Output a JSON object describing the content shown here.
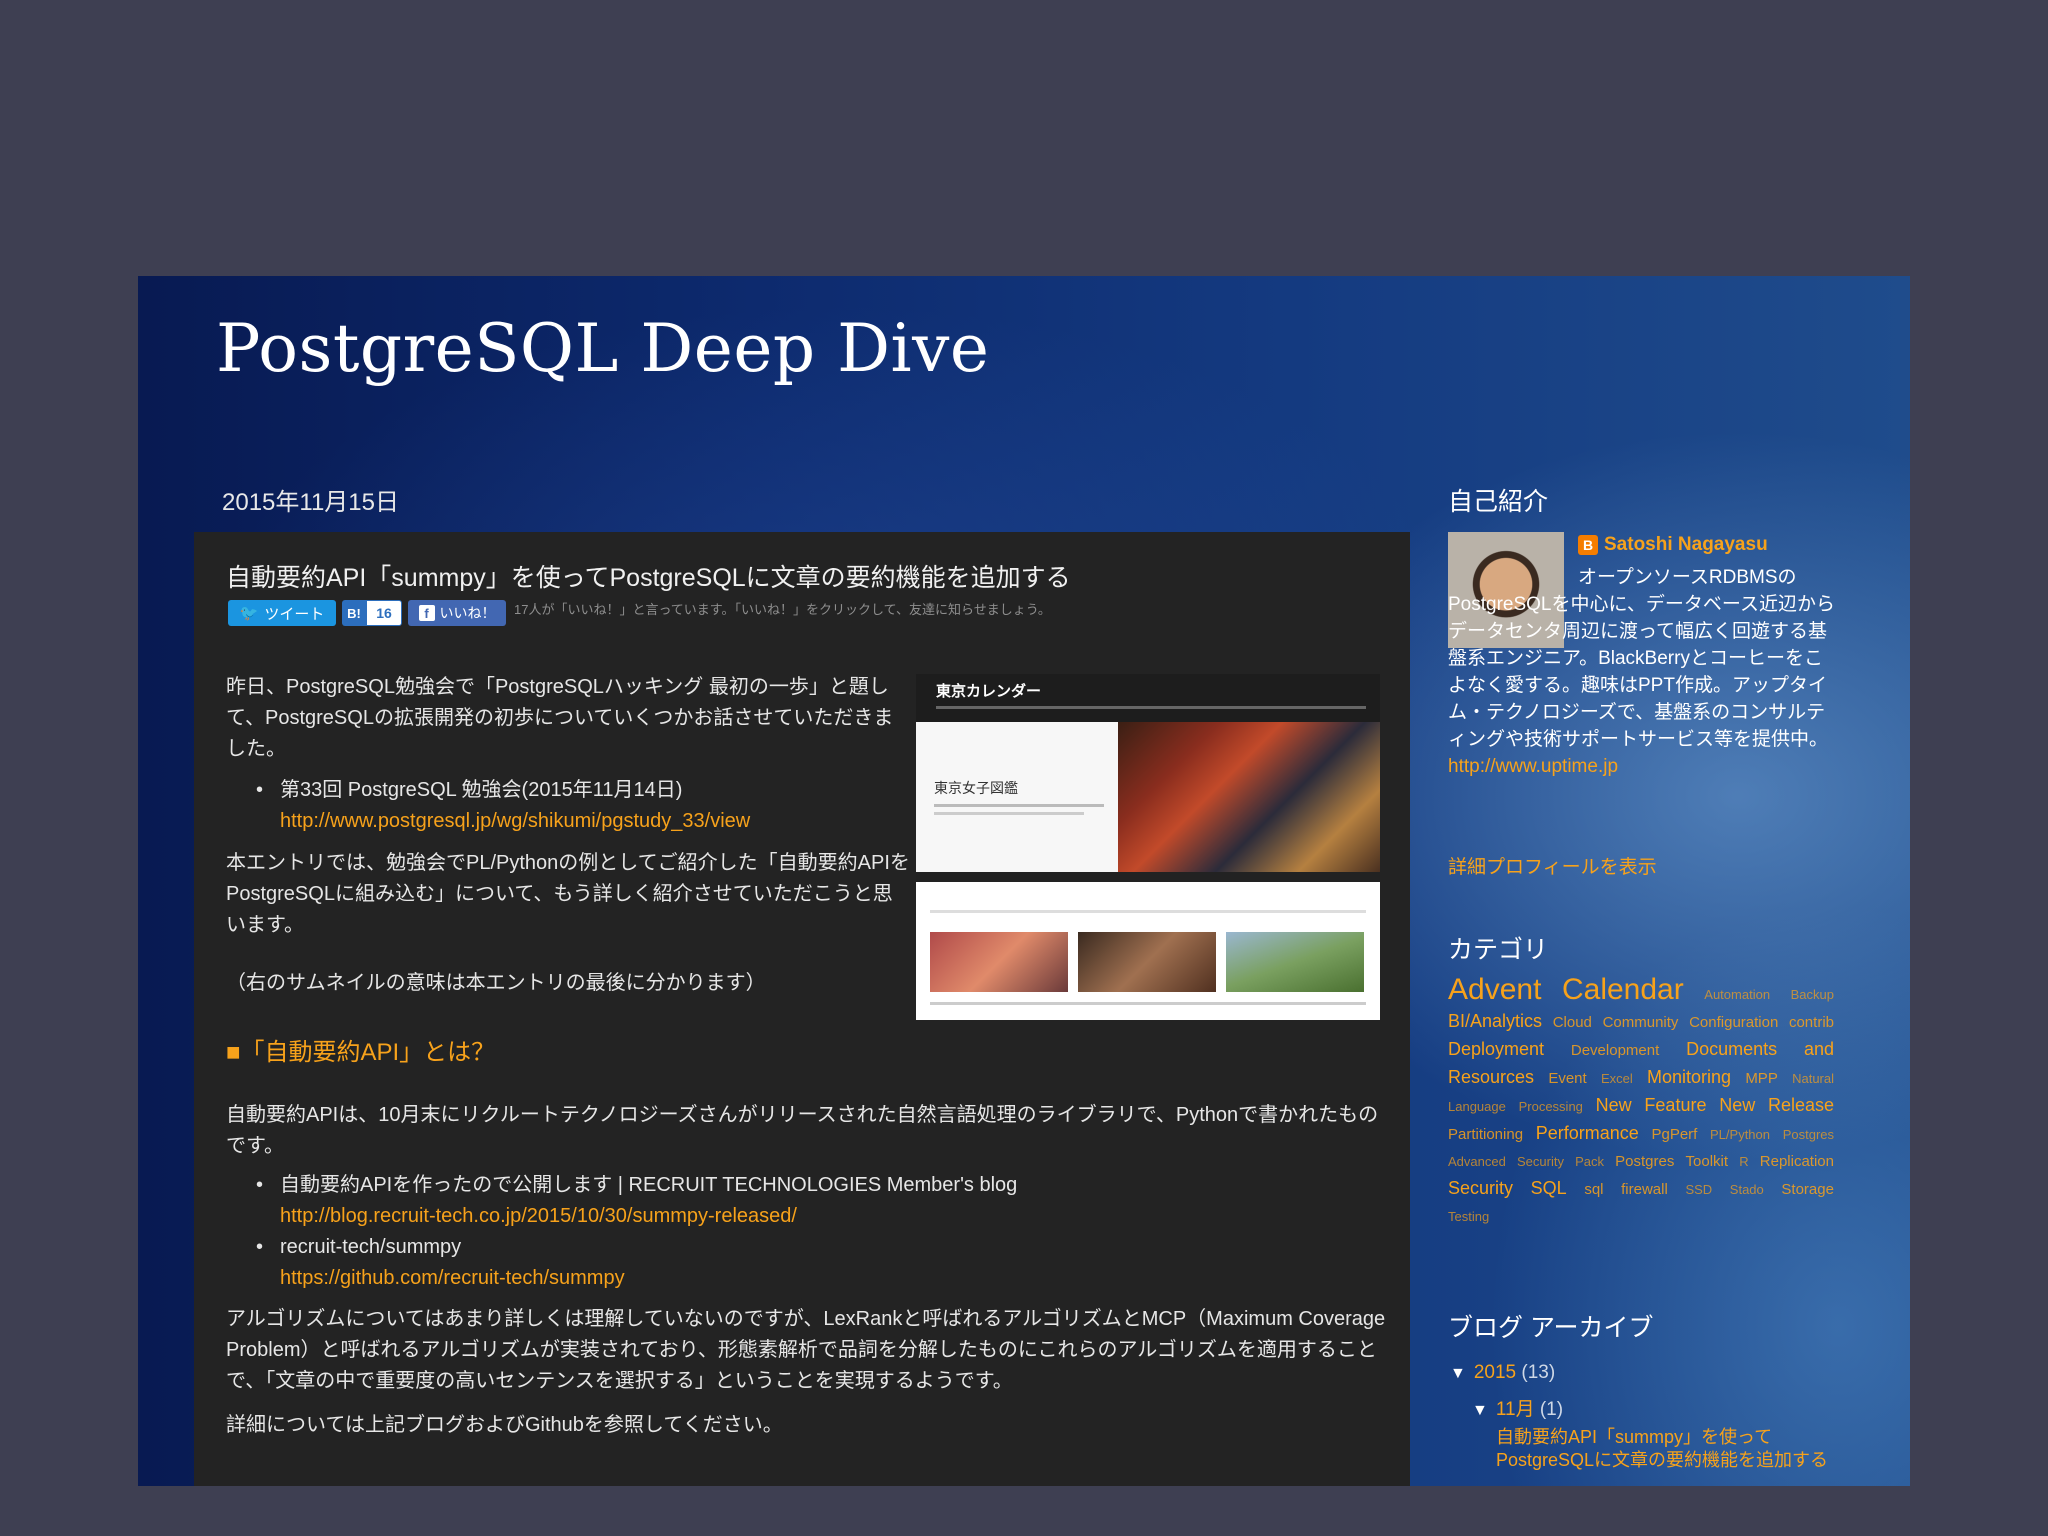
{
  "blog_title": "PostgreSQL Deep Dive",
  "post": {
    "date": "2015年11月15日",
    "title": "自動要約API「summpy」を使ってPostgreSQLに文章の要約機能を追加する",
    "share": {
      "tweet_label": "ツイート",
      "hatena_label": "B!",
      "hatena_count": "16",
      "like_label": "いいね！",
      "like_note": "17人が「いいね！」と言っています。「いいね！」をクリックして、友達に知らせましょう。"
    },
    "p1": "昨日、PostgreSQL勉強会で「PostgreSQLハッキング 最初の一歩」と題して、PostgreSQLの拡張開発の初歩についていくつかお話させていただきました。",
    "bullet1": {
      "text": "第33回 PostgreSQL 勉強会(2015年11月14日)",
      "link": "http://www.postgresql.jp/wg/shikumi/pgstudy_33/view"
    },
    "p2": "本エントリでは、勉強会でPL/Pythonの例としてご紹介した「自動要約APIをPostgreSQLに組み込む」について、もう詳しく紹介させていただこうと思います。",
    "p3": "（右のサムネイルの意味は本エントリの最後に分かります）",
    "thumbnail_title": "東京カレンダー",
    "thumbnail_subtitle": "東京女子図鑑",
    "section_heading": "■「自動要約API」とは？",
    "p4": "自動要約APIは、10月末にリクルートテクノロジーズさんがリリースされた自然言語処理のライブラリで、Pythonで書かれたものです。",
    "bullet2": [
      {
        "text": "自動要約APIを作ったので公開します | RECRUIT TECHNOLOGIES Member's blog",
        "link": "http://blog.recruit-tech.co.jp/2015/10/30/summpy-released/"
      },
      {
        "text": "recruit-tech/summpy",
        "link": "https://github.com/recruit-tech/summpy"
      }
    ],
    "p5": "アルゴリズムについてはあまり詳しくは理解していないのですが、LexRankと呼ばれるアルゴリズムとMCP（Maximum Coverage Problem）と呼ばれるアルゴリズムが実装されており、形態素解析で品詞を分解したものにこれらのアルゴリズムを適用することで、「文章の中で重要度の高いセンテンスを選択する」ということを実現するようです。",
    "p6": "詳細については上記ブログおよびGithubを参照してください。"
  },
  "sidebar": {
    "about_heading": "自己紹介",
    "profile_name": "Satoshi Nagayasu",
    "profile_text": "オープンソースRDBMSのPostgreSQLを中心に、データベース近辺からデータセンタ周辺に渡って幅広く回遊する基盤系エンジニア。BlackBerryとコーヒーをこよなく愛する。趣味はPPT作成。アップタイム・テクノロジーズで、基盤系のコンサルティングや技術サポートサービス等を提供中。",
    "profile_link": "http://www.uptime.jp",
    "profile_more": "詳細プロフィールを表示",
    "category_heading": "カテゴリ",
    "categories": [
      {
        "label": "Advent",
        "size": 4
      },
      {
        "label": "Calendar",
        "size": 4
      },
      {
        "label": "Automation",
        "size": 1
      },
      {
        "label": "Backup",
        "size": 1
      },
      {
        "label": "BI/Analytics",
        "size": 3
      },
      {
        "label": "Cloud",
        "size": 2
      },
      {
        "label": "Community",
        "size": 2
      },
      {
        "label": "Configuration",
        "size": 2
      },
      {
        "label": "contrib",
        "size": 2
      },
      {
        "label": "Deployment",
        "size": 3
      },
      {
        "label": "Development",
        "size": 2
      },
      {
        "label": "Documents",
        "size": 3
      },
      {
        "label": "and",
        "size": 3
      },
      {
        "label": "Resources",
        "size": 3
      },
      {
        "label": "Event",
        "size": 2
      },
      {
        "label": "Excel",
        "size": 1
      },
      {
        "label": "Monitoring",
        "size": 3
      },
      {
        "label": "MPP",
        "size": 2
      },
      {
        "label": "Natural",
        "size": 1
      },
      {
        "label": "Language",
        "size": 1
      },
      {
        "label": "Processing",
        "size": 1
      },
      {
        "label": "New",
        "size": 3
      },
      {
        "label": "Feature",
        "size": 3
      },
      {
        "label": "New",
        "size": 3
      },
      {
        "label": "Release",
        "size": 3
      },
      {
        "label": "Partitioning",
        "size": 2
      },
      {
        "label": "Performance",
        "size": 3
      },
      {
        "label": "PgPerf",
        "size": 2
      },
      {
        "label": "PL/Python",
        "size": 1
      },
      {
        "label": "Postgres",
        "size": 1
      },
      {
        "label": "Advanced",
        "size": 1
      },
      {
        "label": "Security",
        "size": 1
      },
      {
        "label": "Pack",
        "size": 1
      },
      {
        "label": "Postgres",
        "size": 2
      },
      {
        "label": "Toolkit",
        "size": 2
      },
      {
        "label": "R",
        "size": 1
      },
      {
        "label": "Replication",
        "size": 2
      },
      {
        "label": "Security",
        "size": 3
      },
      {
        "label": "SQL",
        "size": 3
      },
      {
        "label": "sql",
        "size": 2
      },
      {
        "label": "firewall",
        "size": 2
      },
      {
        "label": "SSD",
        "size": 1
      },
      {
        "label": "Stado",
        "size": 1
      },
      {
        "label": "Storage",
        "size": 2
      },
      {
        "label": "Testing",
        "size": 1
      }
    ],
    "archive_heading": "ブログ アーカイブ",
    "archive": {
      "year": "2015",
      "year_count": "(13)",
      "month": "11月",
      "month_count": "(1)",
      "post": "自動要約API「summpy」を使ってPostgreSQLに文章の要約機能を追加する"
    }
  }
}
